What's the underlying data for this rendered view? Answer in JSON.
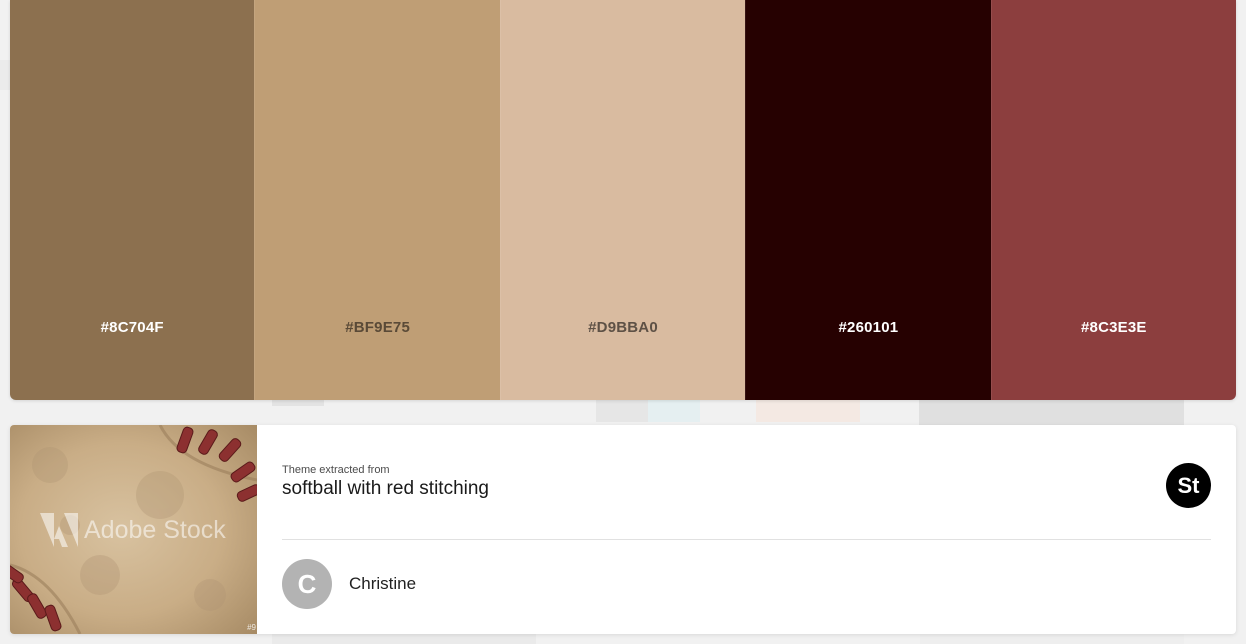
{
  "palette": {
    "swatches": [
      {
        "hex": "#8C704F",
        "color": "#8C704F",
        "text_color": "#ffffff"
      },
      {
        "hex": "#BF9E75",
        "color": "#BF9E75",
        "text_color": "#5a4a37"
      },
      {
        "hex": "#D9BBA0",
        "color": "#D9BBA0",
        "text_color": "#5e5146"
      },
      {
        "hex": "#260101",
        "color": "#260101",
        "text_color": "#ffffff"
      },
      {
        "hex": "#8C3E3E",
        "color": "#8C3E3E",
        "text_color": "#ffffff"
      }
    ]
  },
  "theme_card": {
    "thumbnail": {
      "watermark": "Adobe Stock",
      "image_id": "#9"
    },
    "extracted_label": "Theme extracted from",
    "title": "softball with red stitching",
    "stock_badge": "St",
    "author": {
      "initial": "C",
      "name": "Christine"
    }
  }
}
